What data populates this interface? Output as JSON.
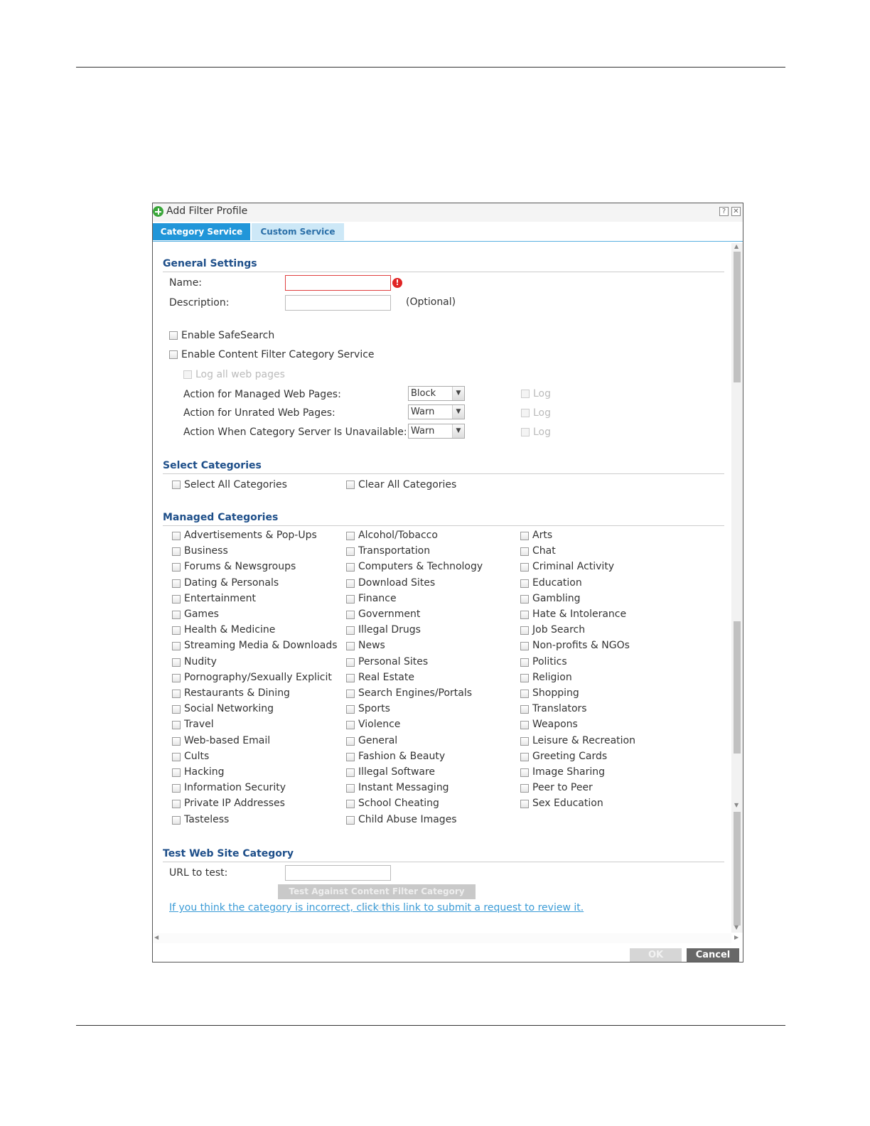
{
  "dialog": {
    "title": "Add Filter Profile",
    "tabs": [
      {
        "label": "Category Service",
        "active": true
      },
      {
        "label": "Custom Service",
        "active": false
      }
    ],
    "help_glyph": "?",
    "close_glyph": "✕"
  },
  "general": {
    "heading": "General Settings",
    "name_label": "Name:",
    "name_value": "",
    "description_label": "Description:",
    "description_value": "",
    "optional_text": "(Optional)",
    "error_glyph": "!",
    "enable_safesearch": "Enable SafeSearch",
    "enable_cf_service": "Enable Content Filter Category Service",
    "log_all_pages": "Log all web pages",
    "actions": [
      {
        "label": "Action for Managed Web Pages:",
        "value": "Block",
        "log": "Log"
      },
      {
        "label": "Action for Unrated Web Pages:",
        "value": "Warn",
        "log": "Log"
      },
      {
        "label": "Action When Category Server Is Unavailable:",
        "value": "Warn",
        "log": "Log"
      }
    ]
  },
  "select_categories": {
    "heading": "Select Categories",
    "select_all": "Select All Categories",
    "clear_all": "Clear All Categories"
  },
  "managed": {
    "heading": "Managed Categories",
    "col1": [
      "Advertisements & Pop-Ups",
      "Business",
      "Forums & Newsgroups",
      "Dating & Personals",
      "Entertainment",
      "Games",
      "Health & Medicine",
      "Streaming Media & Downloads",
      "Nudity",
      "Pornography/Sexually Explicit",
      "Restaurants & Dining",
      "Social Networking",
      "Travel",
      "Web-based Email",
      "Cults",
      "Hacking",
      "Information Security",
      "Private IP Addresses",
      "Tasteless"
    ],
    "col2": [
      "Alcohol/Tobacco",
      "Transportation",
      "Computers & Technology",
      "Download Sites",
      "Finance",
      "Government",
      "Illegal Drugs",
      "News",
      "Personal Sites",
      "Real Estate",
      "Search Engines/Portals",
      "Sports",
      "Violence",
      "General",
      "Fashion & Beauty",
      "Illegal Software",
      "Instant Messaging",
      "School Cheating",
      "Child Abuse Images"
    ],
    "col3": [
      "Arts",
      "Chat",
      "Criminal Activity",
      "Education",
      "Gambling",
      "Hate & Intolerance",
      "Job Search",
      "Non-profits & NGOs",
      "Politics",
      "Religion",
      "Shopping",
      "Translators",
      "Weapons",
      "Leisure & Recreation",
      "Greeting Cards",
      "Image Sharing",
      "Peer to Peer",
      "Sex Education"
    ]
  },
  "test": {
    "heading": "Test Web Site Category",
    "url_label": "URL to test:",
    "url_value": "",
    "test_button": "Test Against Content Filter Category Server",
    "review_link": "If you think the category is incorrect, click this link to submit a request to review it."
  },
  "footer": {
    "ok": "OK",
    "cancel": "Cancel"
  }
}
